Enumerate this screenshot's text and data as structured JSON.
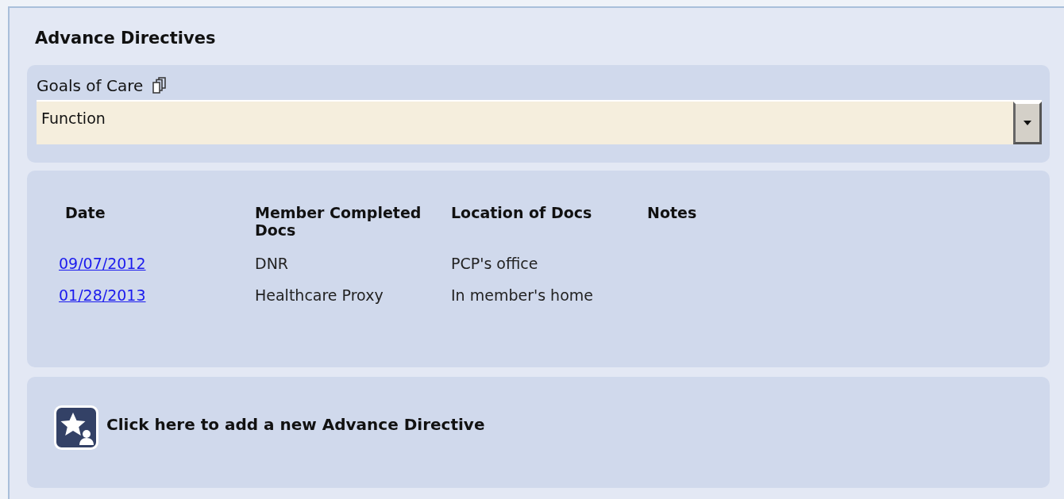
{
  "title": "Advance Directives",
  "goals": {
    "label": "Goals of Care",
    "value": "Function"
  },
  "table": {
    "columns": [
      "Date",
      "Member Completed Docs",
      "Location of Docs",
      "Notes"
    ],
    "rows": [
      {
        "date": "09/07/2012",
        "docs": "DNR",
        "location": "PCP's office"
      },
      {
        "date": "01/28/2013",
        "docs": "Healthcare Proxy",
        "location": "In member's home"
      }
    ]
  },
  "add_link": "Click here to add a new Advance Directive"
}
